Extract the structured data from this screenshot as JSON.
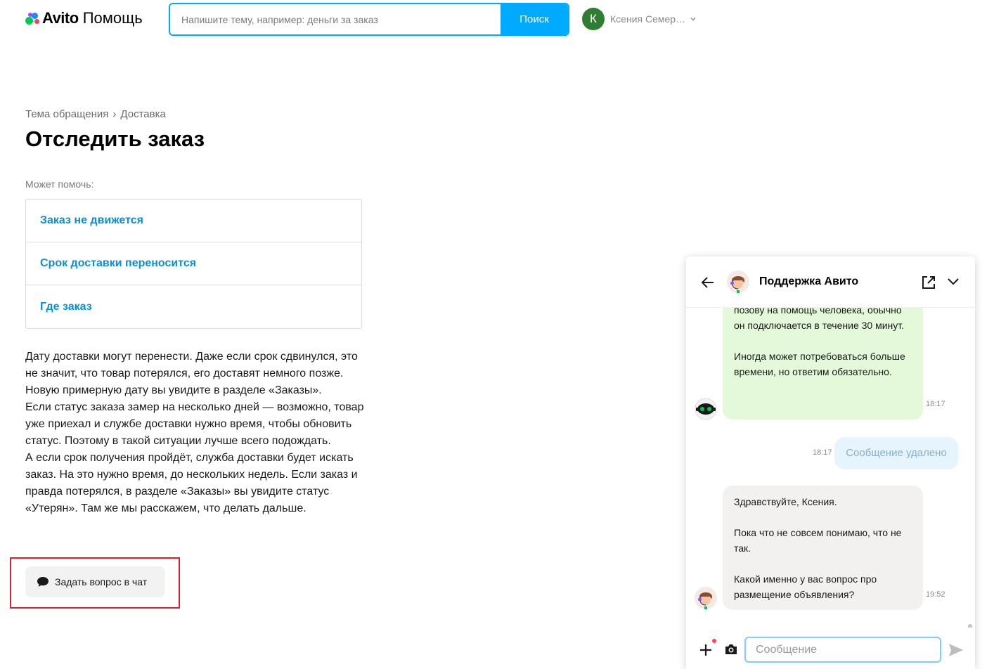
{
  "header": {
    "logo_brand": "Avito",
    "logo_title": "Помощь",
    "search_placeholder": "Напишите тему, например: деньги за заказ",
    "search_button": "Поиск",
    "user_initial": "К",
    "user_name": "Ксения Семер…"
  },
  "breadcrumb": {
    "topic": "Тема обращения",
    "separator": "›",
    "section": "Доставка"
  },
  "page": {
    "title": "Отследить заказ",
    "help_label": "Может помочь:",
    "help_items": [
      {
        "label": "Заказ не движется"
      },
      {
        "label": "Срок доставки переносится"
      },
      {
        "label": "Где заказ"
      }
    ],
    "article": [
      "Дату доставки могут перенести. Даже если срок сдвинулся, это не значит, что товар потерялся, его доставят немного позже. Новую примерную дату вы увидите в разделе «Заказы».",
      "Если статус заказа замер на несколько дней — возможно, товар уже приехал и службе доставки нужно время, чтобы обновить статус. Поэтому в такой ситуации лучше всего подождать.",
      "А если срок получения пройдёт, служба доставки будет искать заказ. На это нужно время, до нескольких недель. Если заказ и правда потерялся, в разделе «Заказы» вы увидите статус «Утерян». Там же мы расскажем, что делать дальше."
    ],
    "ask_button": "Задать вопрос в чат"
  },
  "chat": {
    "title": "Поддержка Авито",
    "messages": [
      {
        "text": "позову на помощь человека, обычно он подключается в течение 30 минут.\n\nИногда может потребоваться больше времени, но ответим обязательно.",
        "time": "18:17"
      },
      {
        "text": "Сообщение удалено",
        "time": "18:17"
      },
      {
        "text": "Здравствуйте, Ксения.\n\nПока что не совсем понимаю, что не так.\n\nКакой именно у вас вопрос про размещение объявления?",
        "time": "19:52"
      }
    ],
    "input_placeholder": "Сообщение"
  },
  "colors": {
    "accent": "#00aaff",
    "link": "#0a8fd6",
    "bot_bubble": "#e4f9d9",
    "deleted_bubble": "#e6f4fd",
    "agent_bubble": "#f2f1ef",
    "highlight": "#e0202e"
  },
  "icons": [
    "avito-logo-icon",
    "chevron-down-icon",
    "breadcrumb-chevron-icon",
    "speech-bubble-icon",
    "arrow-left-icon",
    "support-agent-icon",
    "external-link-icon",
    "bot-icon",
    "plus-icon",
    "camera-icon",
    "send-icon"
  ]
}
